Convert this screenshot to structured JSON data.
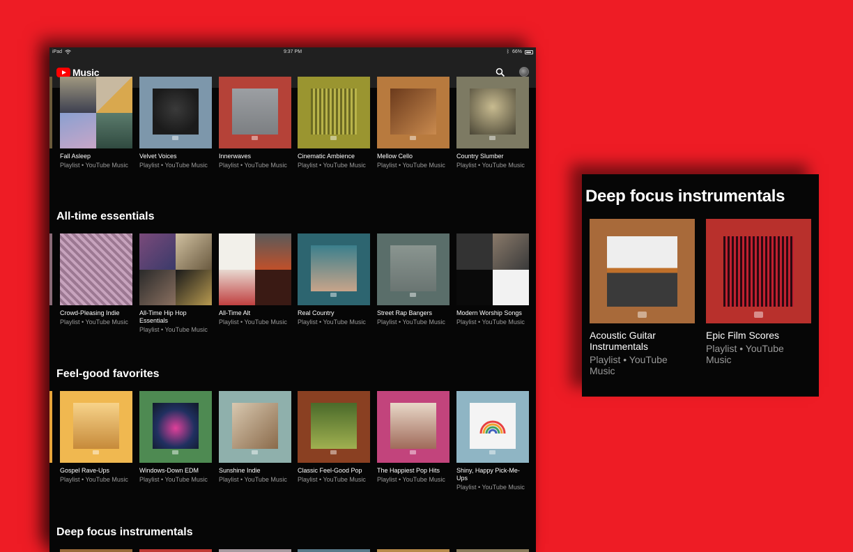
{
  "status_bar": {
    "device": "iPad",
    "time": "9:37 PM",
    "battery": "66%"
  },
  "app": {
    "logo_text": "Music",
    "search_icon": "search-icon",
    "avatar": "account-avatar"
  },
  "colors": {
    "background": "#ee1c25",
    "app_bg": "#060606",
    "bar_bg": "#202020",
    "brand_red": "#ff0000"
  },
  "shelves": [
    {
      "title": "",
      "items": [
        {
          "title": "Fall Asleep",
          "subtitle": "Playlist • YouTube Music"
        },
        {
          "title": "Velvet Voices",
          "subtitle": "Playlist • YouTube Music"
        },
        {
          "title": "Innerwaves",
          "subtitle": "Playlist • YouTube Music"
        },
        {
          "title": "Cinematic Ambience",
          "subtitle": "Playlist • YouTube Music"
        },
        {
          "title": "Mellow Cello",
          "subtitle": "Playlist • YouTube Music"
        },
        {
          "title": "Country Slumber",
          "subtitle": "Playlist • YouTube Music"
        }
      ]
    },
    {
      "title": "All-time essentials",
      "items": [
        {
          "title": "Crowd-Pleasing Indie",
          "subtitle": "Playlist • YouTube Music"
        },
        {
          "title": "All-Time Hip Hop Essentials",
          "subtitle": "Playlist • YouTube Music"
        },
        {
          "title": "All-Time Alt",
          "subtitle": "Playlist • YouTube Music"
        },
        {
          "title": "Real Country",
          "subtitle": "Playlist • YouTube Music"
        },
        {
          "title": "Street Rap Bangers",
          "subtitle": "Playlist • YouTube Music"
        },
        {
          "title": "Modern Worship Songs",
          "subtitle": "Playlist • YouTube Music"
        }
      ]
    },
    {
      "title": "Feel-good favorites",
      "items": [
        {
          "title": "Gospel Rave-Ups",
          "subtitle": "Playlist • YouTube Music"
        },
        {
          "title": "Windows-Down EDM",
          "subtitle": "Playlist • YouTube Music"
        },
        {
          "title": "Sunshine Indie",
          "subtitle": "Playlist • YouTube Music"
        },
        {
          "title": "Classic Feel-Good Pop",
          "subtitle": "Playlist • YouTube Music"
        },
        {
          "title": "The Happiest Pop Hits",
          "subtitle": "Playlist • YouTube Music"
        },
        {
          "title": "Shiny, Happy Pick-Me-Ups",
          "subtitle": "Playlist • YouTube Music"
        }
      ]
    },
    {
      "title": "Deep focus instrumentals",
      "items": []
    }
  ],
  "callout": {
    "title": "Deep focus instrumentals",
    "items": [
      {
        "title": "Acoustic Guitar Instrumentals",
        "subtitle": "Playlist • YouTube Music"
      },
      {
        "title": "Epic Film Scores",
        "subtitle": "Playlist • YouTube Music"
      }
    ]
  }
}
